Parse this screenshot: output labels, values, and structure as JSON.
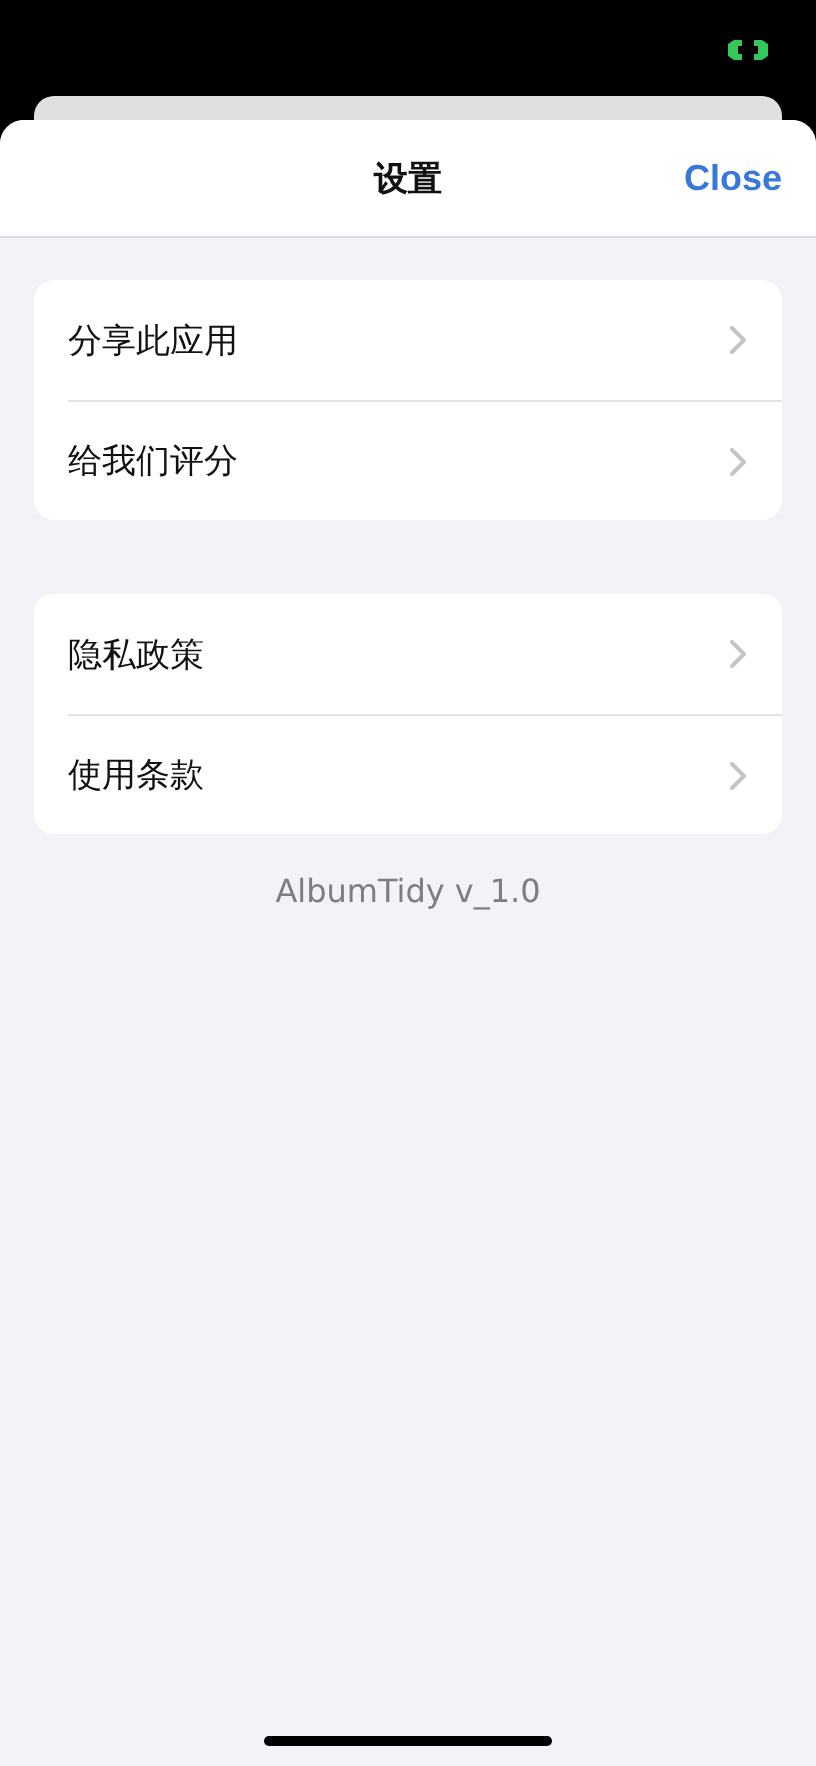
{
  "header": {
    "title": "设置",
    "close_label": "Close"
  },
  "groups": [
    {
      "items": [
        {
          "label": "分享此应用"
        },
        {
          "label": "给我们评分"
        }
      ]
    },
    {
      "items": [
        {
          "label": "隐私政策"
        },
        {
          "label": "使用条款"
        }
      ]
    }
  ],
  "version": "AlbumTidy v_1.0"
}
